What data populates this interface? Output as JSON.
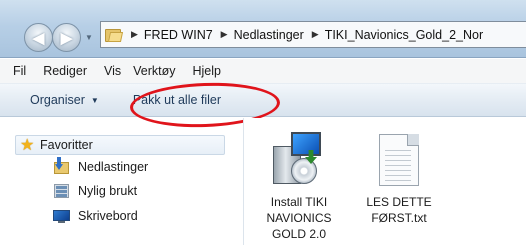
{
  "address_bar": {
    "breadcrumbs": [
      "FRED WIN7",
      "Nedlastinger",
      "TIKI_Navionics_Gold_2_Nor"
    ]
  },
  "menubar": {
    "items": [
      "Fil",
      "Rediger",
      "Vis",
      "Verktøy",
      "Hjelp"
    ]
  },
  "commandbar": {
    "organize_label": "Organiser",
    "extract_label": "Pakk ut alle filer"
  },
  "navigation": {
    "favorites_label": "Favoritter",
    "items": [
      "Nedlastinger",
      "Nylig brukt",
      "Skrivebord"
    ]
  },
  "files": [
    {
      "name_lines": [
        "Install TIKI",
        "NAVIONICS",
        "GOLD 2.0"
      ],
      "icon": "installer-icon"
    },
    {
      "name_lines": [
        "LES DETTE",
        "FØRST.txt"
      ],
      "icon": "text-file-icon"
    }
  ],
  "colors": {
    "annotation_oval": "#e0141b",
    "title_gradient": "#b7cfe6"
  }
}
